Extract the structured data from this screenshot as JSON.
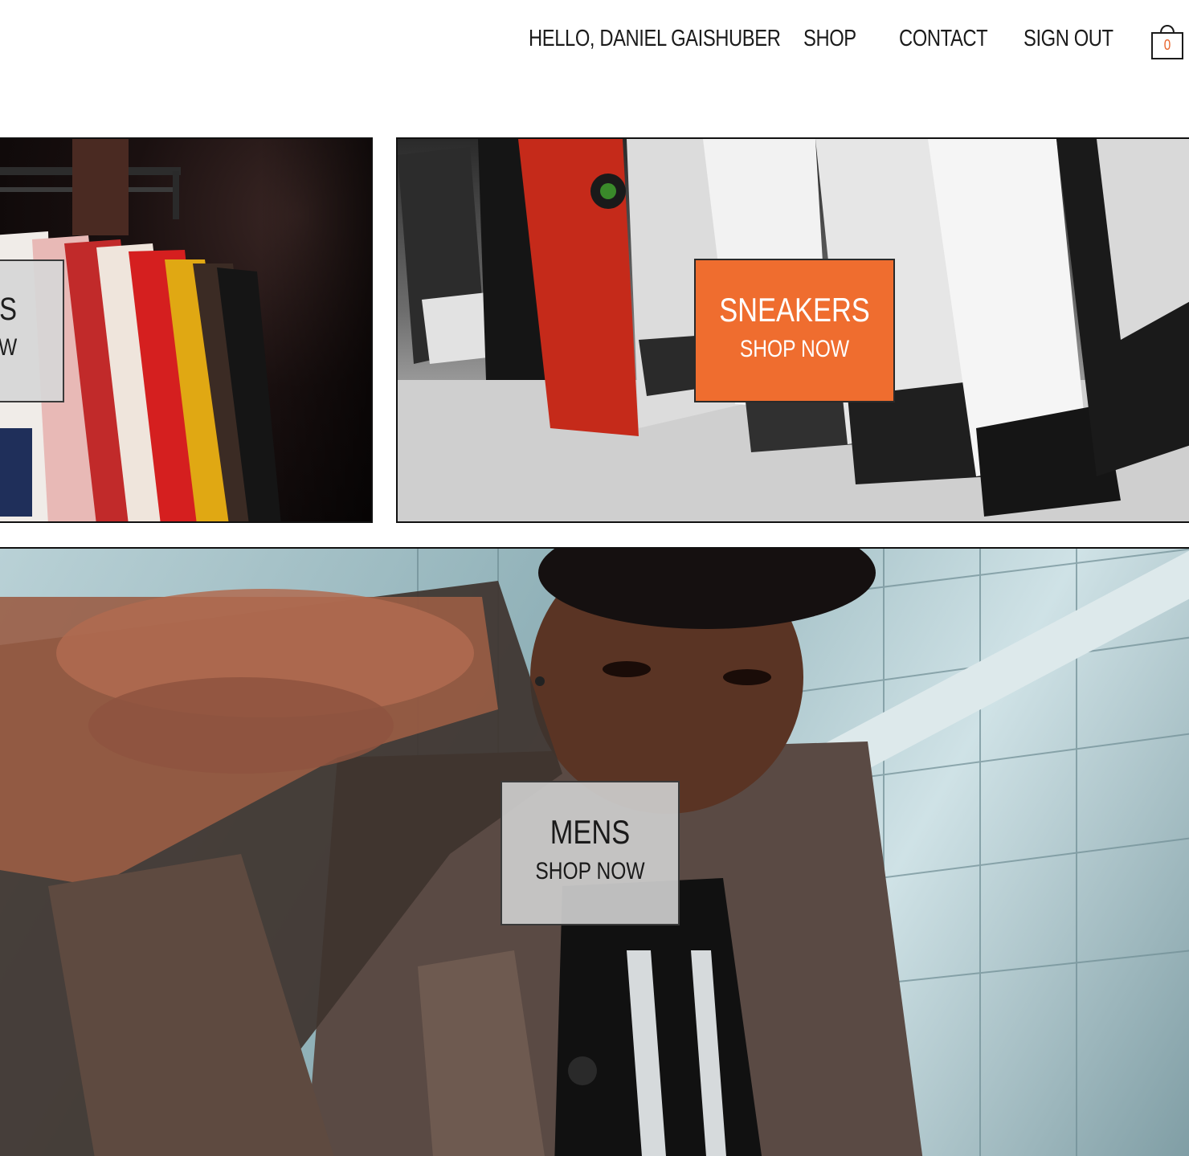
{
  "nav": {
    "greeting": "HELLO, DANIEL GAISHUBER",
    "shop": "SHOP",
    "contact": "CONTACT",
    "sign_out": "SIGN OUT"
  },
  "cart": {
    "icon": "shopping-bag-icon",
    "count": "0",
    "accent_color": "#e8642b"
  },
  "tiles": {
    "shirts": {
      "title": "TS",
      "cta": "OW"
    },
    "sneakers": {
      "title": "SNEAKERS",
      "cta": "SHOP NOW",
      "color": "#ef6d2f"
    },
    "mens": {
      "title": "MENS",
      "cta": "SHOP NOW"
    }
  }
}
